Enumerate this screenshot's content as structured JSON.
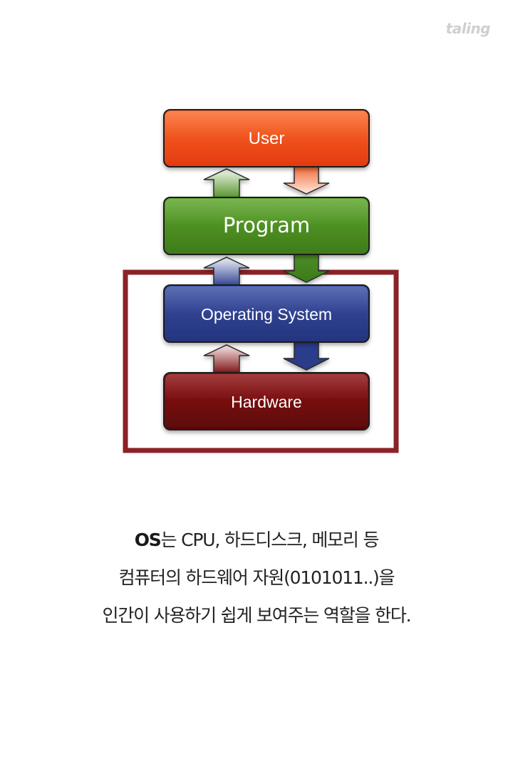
{
  "brand": "taling",
  "diagram": {
    "layers": [
      {
        "id": "user",
        "label": "User"
      },
      {
        "id": "program",
        "label": "Program"
      },
      {
        "id": "os",
        "label": "Operating System"
      },
      {
        "id": "hardware",
        "label": "Hardware"
      }
    ],
    "highlight_color": "#8b2227",
    "colors": {
      "user": "#f05a1e",
      "program": "#4e8f22",
      "os": "#2c3f8f",
      "hardware": "#7a0b0d"
    }
  },
  "caption": {
    "line1_bold": "OS",
    "line1_rest": "는 CPU, 하드디스크, 메모리 등",
    "line2": "컴퓨터의 하드웨어 자원(0101011..)을",
    "line3": "인간이 사용하기 쉽게 보여주는 역할을 한다."
  }
}
